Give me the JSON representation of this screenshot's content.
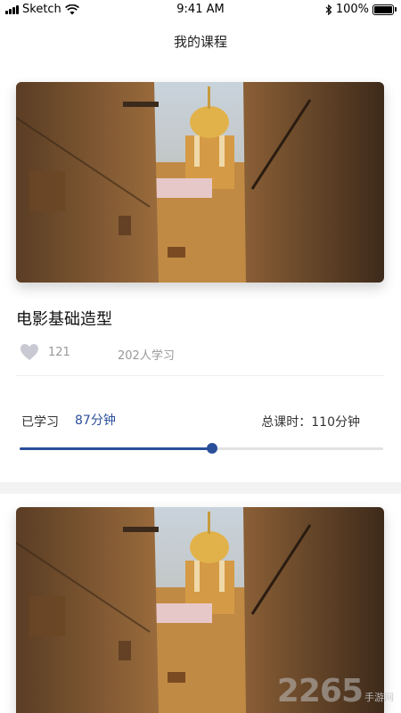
{
  "status_bar": {
    "carrier": "Sketch",
    "time": "9:41 AM",
    "battery": "100%"
  },
  "header": {
    "title": "我的课程"
  },
  "course": {
    "title": "电影基础造型",
    "likes": "121",
    "learners": "202人学习",
    "studied_label": "已学习",
    "studied_value": "87分钟",
    "total_label": "总课时：110分钟",
    "progress_fraction": 0.53
  },
  "watermark": {
    "main": "2265",
    "sub": "手游网"
  },
  "colors": {
    "accent": "#2a4f9a",
    "muted": "#999999",
    "heart": "#c9c9d4"
  }
}
